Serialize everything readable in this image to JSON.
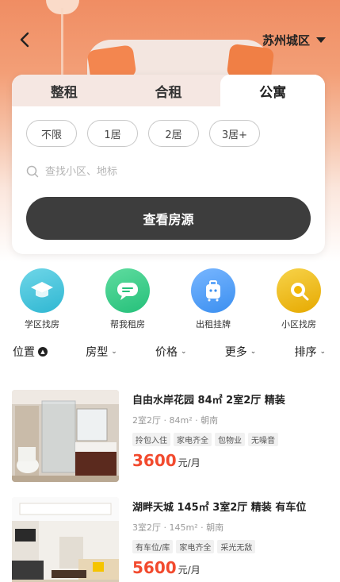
{
  "header": {
    "city": "苏州城区"
  },
  "search_card": {
    "tabs": [
      {
        "label": "整租",
        "active": false
      },
      {
        "label": "合租",
        "active": false
      },
      {
        "label": "公寓",
        "active": true
      }
    ],
    "room_filters": [
      "不限",
      "1居",
      "2居",
      "3居+"
    ],
    "search_placeholder": "查找小区、地标",
    "cta_label": "查看房源"
  },
  "quick_links": [
    {
      "label": "学区找房",
      "icon": "graduation-cap-icon",
      "color": "#2fb7d2"
    },
    {
      "label": "帮我租房",
      "icon": "chat-bubble-icon",
      "color": "#25c07a"
    },
    {
      "label": "出租挂牌",
      "icon": "suitcase-icon",
      "color": "#3b8ff0"
    },
    {
      "label": "小区找房",
      "icon": "magnifier-icon",
      "color": "#f2b705"
    }
  ],
  "filter_bar": [
    {
      "label": "位置"
    },
    {
      "label": "房型"
    },
    {
      "label": "价格"
    },
    {
      "label": "更多"
    },
    {
      "label": "排序"
    }
  ],
  "listings": [
    {
      "title": "自由水岸花园 84㎡ 2室2厅 精装",
      "meta": "2室2厅 · 84m² · 朝南",
      "tags": [
        "拎包入住",
        "家电齐全",
        "包物业",
        "无噪音"
      ],
      "price": "3600",
      "unit": "元/月"
    },
    {
      "title": "湖畔天城 145㎡ 3室2厅 精装 有车位",
      "meta": "3室2厅 · 145m² · 朝南",
      "tags": [
        "有车位/库",
        "家电齐全",
        "采光无敌"
      ],
      "price": "5600",
      "unit": "元/月"
    }
  ],
  "colors": {
    "accent_price": "#f24a2e",
    "cta_bg": "#3d3d3d",
    "hero_top": "#f08d63"
  }
}
